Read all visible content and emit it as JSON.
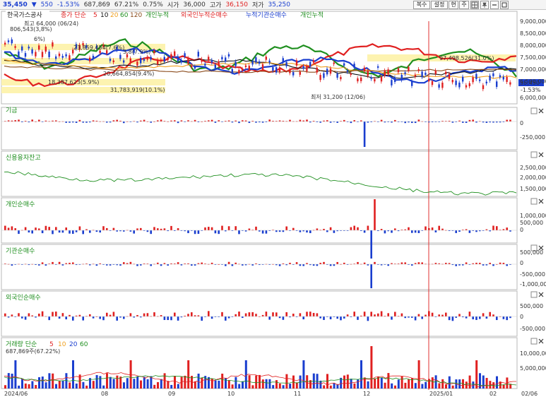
{
  "header": {
    "price": "35,450",
    "arrow": "▼",
    "change": "550",
    "change_pct": "-1.53%",
    "volume": "687,869",
    "turnover_pct": "67.21%",
    "pct2": "0.75%",
    "open_label": "시가",
    "open": "36,000",
    "high_label": "고가",
    "high": "36,150",
    "low_label": "저가",
    "low": "35,250",
    "buttons": [
      "복수",
      "설정",
      "현",
      "주"
    ]
  },
  "main_panel": {
    "stock_name": "한국가스공사",
    "ma_label": "종가 단순",
    "ma_periods": [
      "5",
      "10",
      "20",
      "60",
      "120"
    ],
    "legend": [
      "개인누적",
      "외국인누적순매수",
      "누적기관순매수",
      "개인누적"
    ],
    "annotations": {
      "high": "최고 64,000 (06/24)",
      "low": "최저 31,200 (12/06)",
      "a1": "806,543(3,8%)",
      "a2": "6%)",
      "a3": "23,859,454(7.6%)",
      "a4": "3.8(7.9%)",
      "a5": "18,387,623(5.9%)",
      "a6": "20,664,854(9.4%)",
      "a7": "31,783,919(10.1%)",
      "a8": "97,498,526(31.0%)",
      "current_price": "35,450",
      "current_pct": "-1.53%"
    },
    "y_ticks": [
      "9,000,000",
      "8,500,000",
      "8,000,000",
      "7,500,000",
      "7,000,000",
      "6,500,000",
      "6,000,000"
    ]
  },
  "panels": [
    {
      "title": "기금",
      "ticks": [
        "0",
        "-250,000"
      ]
    },
    {
      "title": "신용융자잔고",
      "ticks": [
        "2,500,000",
        "2,000,000",
        "1,500,000"
      ]
    },
    {
      "title": "개인순매수",
      "ticks": [
        "1,000,000",
        "500,000",
        "0"
      ]
    },
    {
      "title": "기관순매수",
      "ticks": [
        "500,000",
        "0",
        "-500,000",
        "-1,000,000"
      ]
    },
    {
      "title": "외국인순매수",
      "ticks": [
        "500,000",
        "0",
        "-500,000"
      ]
    },
    {
      "title": "거래량 단순",
      "ma": [
        "5",
        "10",
        "20",
        "60"
      ],
      "sub": "687,869주(67.22%)",
      "ticks": [
        "10,000,000",
        "5,000,000"
      ]
    }
  ],
  "x_labels": [
    "2024/06",
    "08",
    "09",
    "10",
    "11",
    "12",
    "2025/01",
    "02",
    "02/06"
  ],
  "colors": {
    "up": "#e02020",
    "down": "#1a3ecf",
    "green": "#1f8f1f",
    "dark": "#111111",
    "orange": "#f0a020",
    "highlight": "#fdf3b0"
  }
}
